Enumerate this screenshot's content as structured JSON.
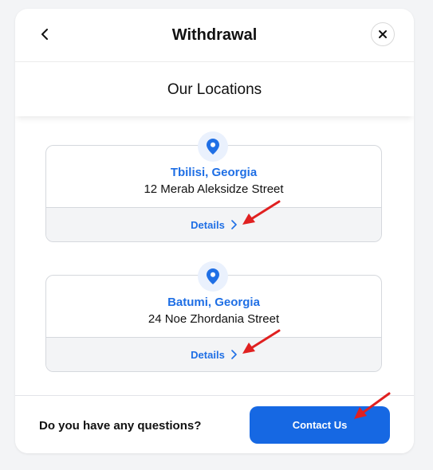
{
  "header": {
    "title": "Withdrawal",
    "back_icon": "chevron-left-icon",
    "close_icon": "close-icon"
  },
  "subheader": {
    "title": "Our Locations"
  },
  "locations": [
    {
      "city": "Tbilisi, Georgia",
      "street": "12 Merab Aleksidze Street",
      "details_label": "Details",
      "icon": "location-pin-icon"
    },
    {
      "city": "Batumi, Georgia",
      "street": "24 Noe Zhordania Street",
      "details_label": "Details",
      "icon": "location-pin-icon"
    }
  ],
  "footer": {
    "question": "Do you have any questions?",
    "contact_label": "Contact Us"
  },
  "colors": {
    "accent": "#1f6fe5",
    "button": "#1668e3",
    "annotation_arrow": "#e02020"
  }
}
